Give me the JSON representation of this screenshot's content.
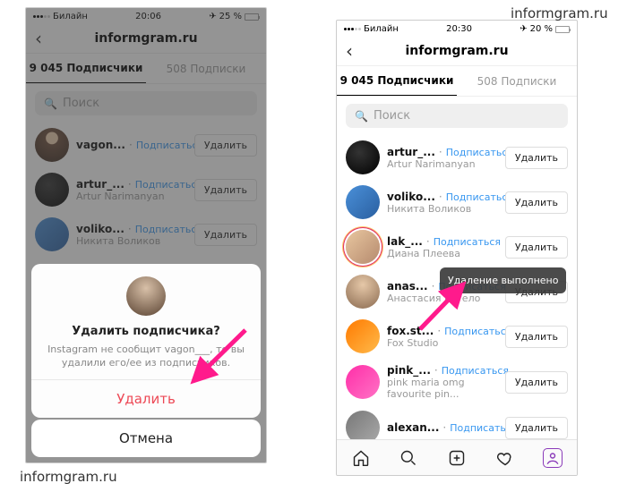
{
  "watermark": "informgram.ru",
  "left": {
    "status": {
      "carrier": "Билайн",
      "time": "20:06",
      "battery_pct": "25 %"
    },
    "header_title": "informgram.ru",
    "tabs": {
      "followers": "9 045 Подписчики",
      "following": "508 Подписки"
    },
    "search_placeholder": "Поиск",
    "follow_label": "Подписаться",
    "remove_label": "Удалить",
    "rows": [
      {
        "username": "vagon...",
        "fullname": ""
      },
      {
        "username": "artur_...",
        "fullname": "Artur Narimanyan"
      },
      {
        "username": "voliko...",
        "fullname": "Никита Воликов"
      }
    ],
    "sheet": {
      "question": "Удалить подписчика?",
      "desc_before": "Instagram не сообщит vagon___",
      "desc_after": "то вы удалили его/ее из подписчиков.",
      "confirm": "Удалить",
      "cancel": "Отмена"
    }
  },
  "right": {
    "status": {
      "carrier": "Билайн",
      "time": "20:30",
      "battery_pct": "20 %"
    },
    "header_title": "informgram.ru",
    "tabs": {
      "followers": "9 045 Подписчики",
      "following": "508 Подписки"
    },
    "search_placeholder": "Поиск",
    "follow_label": "Подписаться",
    "remove_label": "Удалить",
    "toast": "Удаление выполнено",
    "rows": [
      {
        "username": "artur_...",
        "fullname": "Artur Narimanyan"
      },
      {
        "username": "voliko...",
        "fullname": "Никита Воликов"
      },
      {
        "username": "lak_...",
        "fullname": "Диана Плеева"
      },
      {
        "username": "anas...",
        "fullname": "Анастасия Бугело"
      },
      {
        "username": "fox.st...",
        "fullname": "Fox Studio"
      },
      {
        "username": "pink_...",
        "fullname": "pink maria omg favourite pin..."
      },
      {
        "username": "alexan...",
        "fullname": ""
      }
    ]
  }
}
